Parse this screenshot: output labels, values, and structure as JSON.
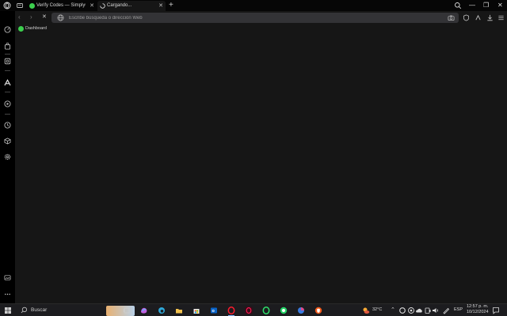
{
  "tabs": [
    {
      "label": "Verify Codes — SimplyCodes",
      "active": false,
      "favicon_color": "#3ccf4e"
    },
    {
      "label": "Cargando...",
      "active": true
    }
  ],
  "toolbar": {
    "address_placeholder": "Escribe búsqueda o dirección Web"
  },
  "bookmarks": [
    {
      "label": "Dashboard",
      "favicon_color": "#3ccf4e"
    }
  ],
  "taskbar": {
    "search_label": "Buscar",
    "weather": "32°C",
    "language": "ESP",
    "time": "12:57 p. m.",
    "date": "10/12/2024"
  },
  "colors": {
    "accent": "#3ccf4e",
    "opera_red": "#ff1b2d"
  }
}
